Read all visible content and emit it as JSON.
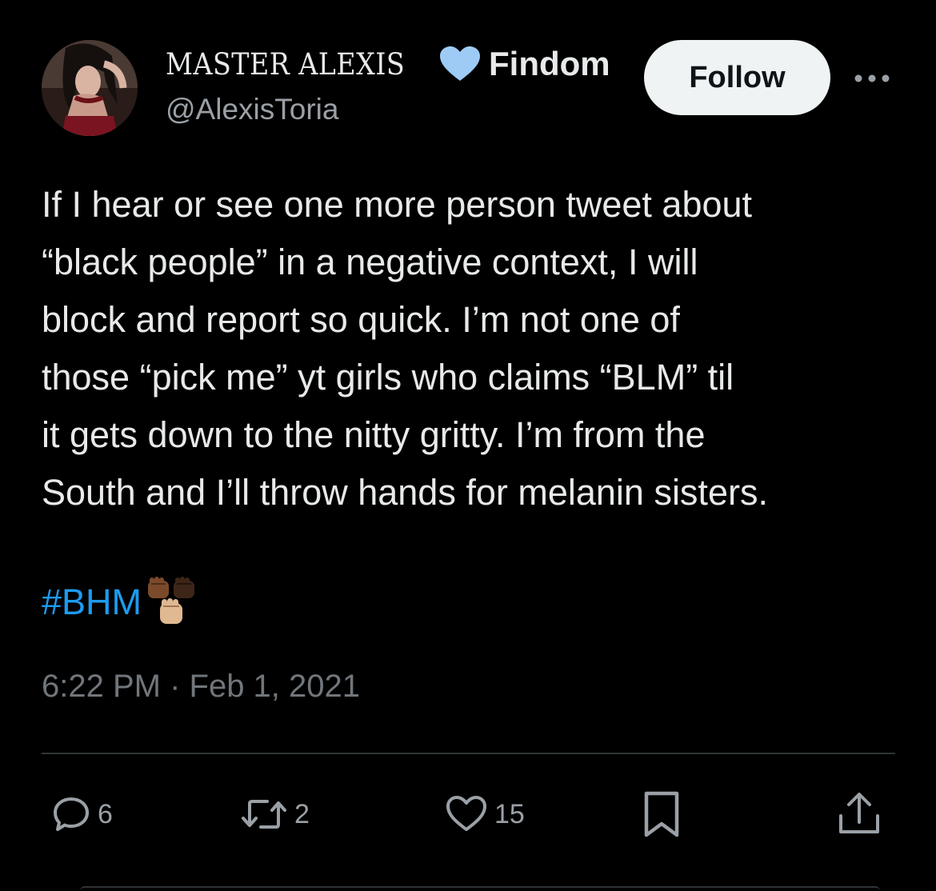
{
  "header": {
    "display_name": "MASTER ALEXIS",
    "badge_icon": "blue-heart-icon",
    "tag": "Findom",
    "handle": "@AlexisToria",
    "follow_label": "Follow",
    "more_icon": "more-dots-icon"
  },
  "tweet": {
    "lines": [
      "If I hear or see one more person tweet about",
      "“black people” in a negative context, I will",
      "block and report so quick. I’m not one of",
      "those “pick me” yt girls who claims “BLM” til",
      "it gets down to the nitty gritty. I’m from the",
      "South and I’ll throw hands for melanin sisters."
    ],
    "hashtag": "#BHM",
    "emoji_icon": "raised-fists-emoji",
    "timestamp": "6:22 PM · Feb 1, 2021"
  },
  "actions": {
    "reply_count": "6",
    "retweet_count": "2",
    "like_count": "15",
    "icons": [
      "reply-icon",
      "retweet-icon",
      "like-icon",
      "bookmark-icon",
      "share-icon"
    ]
  },
  "colors": {
    "background": "#000000",
    "text": "#e7e9ea",
    "secondary": "#71767b",
    "link": "#1d9bf0",
    "badge": "#9ecbf5",
    "follow_bg": "#eff3f4"
  }
}
